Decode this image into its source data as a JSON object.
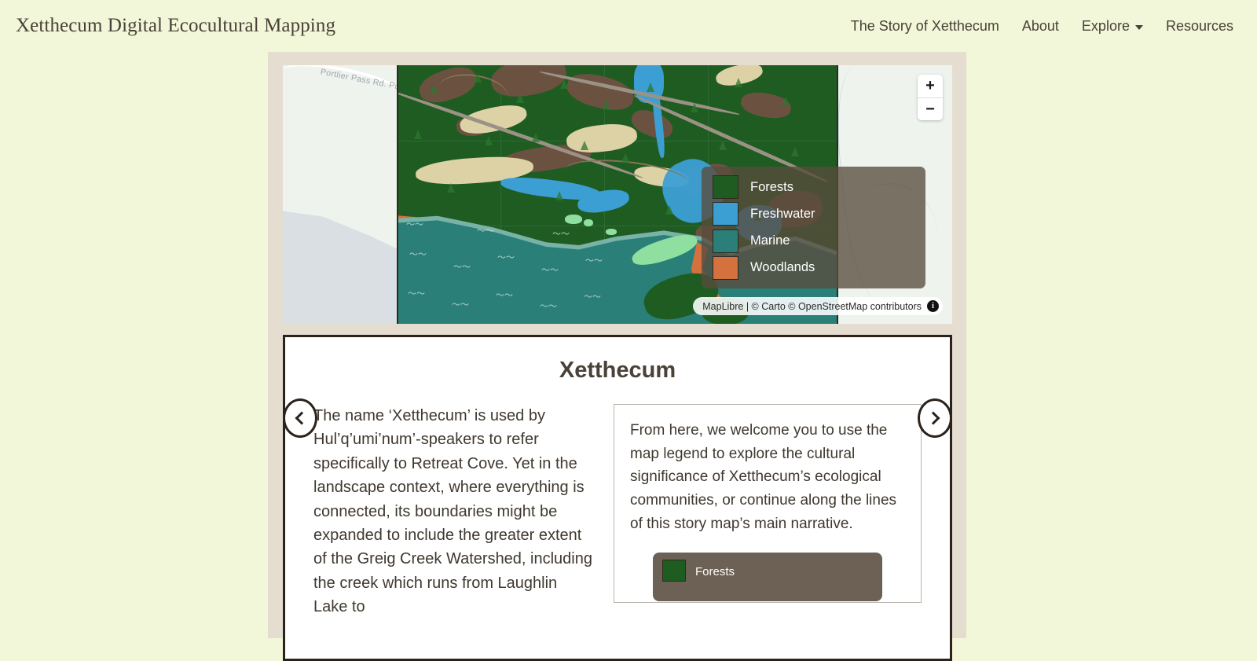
{
  "header": {
    "brand": "Xetthecum Digital Ecocultural Mapping",
    "nav": [
      {
        "label": "The Story of Xetthecum",
        "has_dropdown": false
      },
      {
        "label": "About",
        "has_dropdown": false
      },
      {
        "label": "Explore",
        "has_dropdown": true
      },
      {
        "label": "Resources",
        "has_dropdown": false
      }
    ]
  },
  "map": {
    "zoom_in_label": "+",
    "zoom_out_label": "−",
    "basemap_road_label": "Portlier Pass Rd.  Portl",
    "attribution": "MapLibre | © Carto © OpenStreetMap contributors",
    "info_icon_label": "i",
    "legend": [
      {
        "label": "Forests",
        "color": "#1f5c22"
      },
      {
        "label": "Freshwater",
        "color": "#3c9fd4"
      },
      {
        "label": "Marine",
        "color": "#2a7f78"
      },
      {
        "label": "Woodlands",
        "color": "#d5713f"
      }
    ]
  },
  "story": {
    "title": "Xetthecum",
    "paragraph": "The name ‘Xetthecum’ is used by Hul’q’umi’num’-speakers to refer specifically to Retreat Cove. Yet in the landscape context, where everything is connected, its boundaries might be expanded to include the greater extent of the Greig Creek Watershed, including the creek which runs from Laughlin Lake to",
    "callout": "From here, we welcome you to use the map legend to explore the cultural significance of Xetthecum’s ecological communities, or continue along the lines of this story map’s main narrative.",
    "mini_legend_label": "Forests",
    "prev_label": "‹",
    "next_label": "›"
  },
  "colors": {
    "page_background": "#f1f7d8",
    "container_background": "#e5ddd0",
    "card_border": "#2b221c",
    "text": "#4a4138",
    "legend_panel": "rgba(88,75,60,.78)"
  }
}
